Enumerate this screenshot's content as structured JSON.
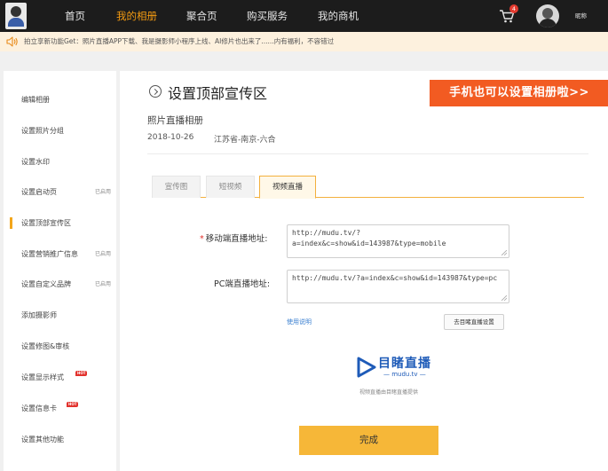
{
  "nav": {
    "items": [
      "首页",
      "我的相册",
      "聚合页",
      "购买服务",
      "我的商机"
    ],
    "active_index": 1,
    "cart_count": "4",
    "nickname": "昵称"
  },
  "notice": {
    "text": "拍立享新功能Get：照片直播APP下载、我是摄影师小程序上线、AI修片也出来了......内有福利，不容错过"
  },
  "sidebar": {
    "items": [
      {
        "label": "编辑相册",
        "tag": ""
      },
      {
        "label": "设置照片分组",
        "tag": ""
      },
      {
        "label": "设置水印",
        "tag": ""
      },
      {
        "label": "设置启动页",
        "tag": "已启用"
      },
      {
        "label": "设置顶部宣传区",
        "tag": ""
      },
      {
        "label": "设置营销推广信息",
        "tag": "已启用"
      },
      {
        "label": "设置自定义品牌",
        "tag": "已启用"
      },
      {
        "label": "添加摄影师",
        "tag": ""
      },
      {
        "label": "设置修图&审核",
        "tag": ""
      },
      {
        "label": "设置显示样式",
        "tag": ""
      },
      {
        "label": "设置信息卡",
        "tag": ""
      },
      {
        "label": "设置其他功能",
        "tag": ""
      }
    ],
    "active_index": 4,
    "hot_label": "HOT"
  },
  "main": {
    "title": "设置顶部宣传区",
    "promo": "手机也可以设置相册啦>>",
    "album_name": "照片直播相册",
    "album_date": "2018-10-26",
    "album_location": "江苏省-南京-六合",
    "tabs": [
      "宣传图",
      "短视频",
      "视频直播"
    ],
    "active_tab": 2,
    "mobile_label": "移动端直播地址:",
    "mobile_value": "http://mudu.tv/?a=index&c=show&id=143987&type=mobile",
    "pc_label": "PC端直播地址:",
    "pc_value": "http://mudu.tv/?a=index&c=show&id=143987&type=pc",
    "help_link": "使用说明",
    "mudu_button": "去目睹直播设置",
    "mudu_logo_cn": "目睹直播",
    "mudu_logo_en": "— mudu.tv —",
    "mudu_caption": "视频直播由目睹直播提供",
    "done_button": "完成"
  },
  "colors": {
    "accent": "#f39a12",
    "nav_bg": "#1c1c1c",
    "promo_bg": "#f25b22",
    "button_yellow": "#f6b738",
    "mudu_blue": "#1e5bb8"
  }
}
